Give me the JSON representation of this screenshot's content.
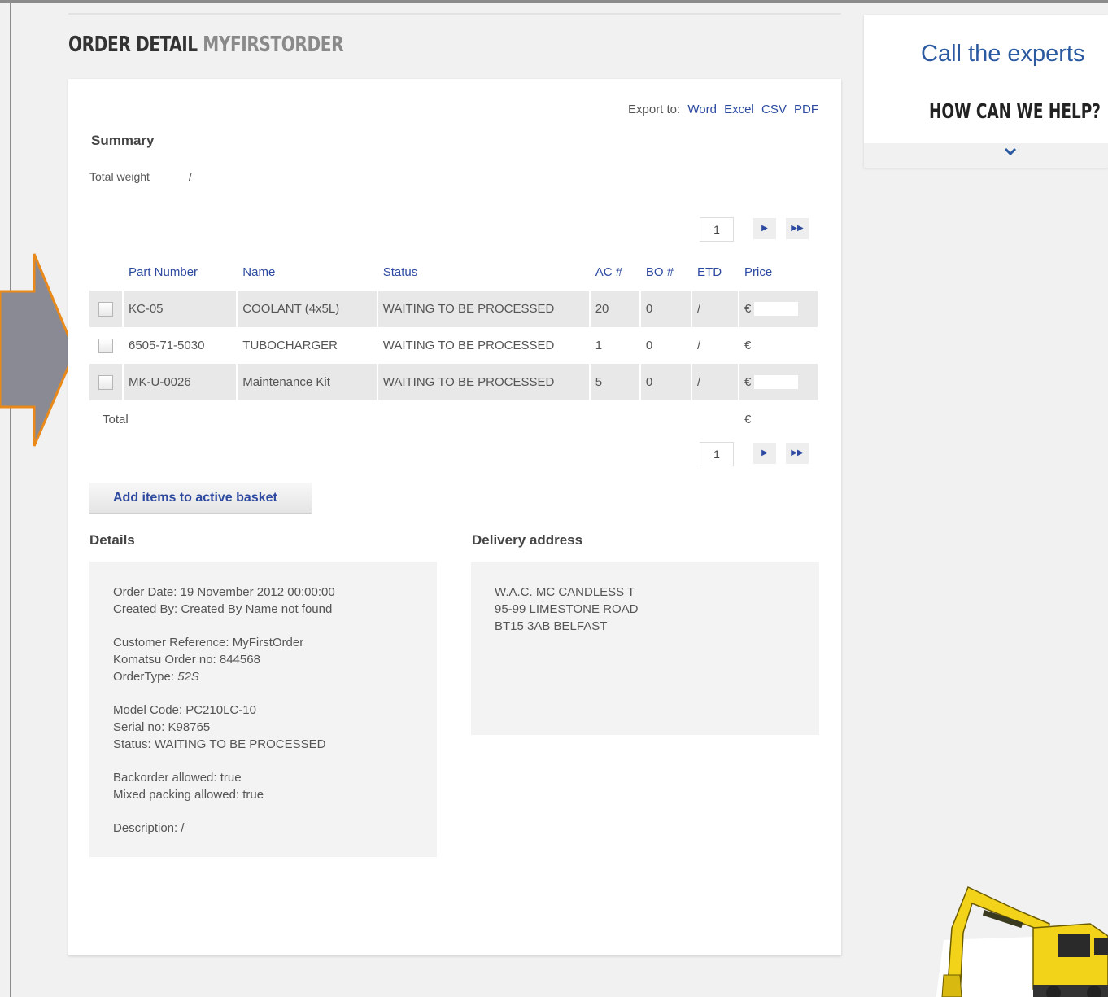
{
  "page": {
    "title_main": "ORDER DETAIL",
    "title_sub": "MYFIRSTORDER"
  },
  "export": {
    "label": "Export to:",
    "links": [
      "Word",
      "Excel",
      "CSV",
      "PDF"
    ]
  },
  "summary": {
    "heading": "Summary",
    "weight_label": "Total weight",
    "weight_value": "/"
  },
  "pager": {
    "page": "1"
  },
  "table": {
    "columns": [
      "Part Number",
      "Name",
      "Status",
      "AC #",
      "BO #",
      "ETD",
      "Price"
    ],
    "rows": [
      {
        "part": "KC-05",
        "name": "COOLANT (4x5L)",
        "status": "WAITING TO BE PROCESSED",
        "ac": "20",
        "bo": "0",
        "etd": "/",
        "price": "€"
      },
      {
        "part": "6505-71-5030",
        "name": "TUBOCHARGER",
        "status": "WAITING TO BE PROCESSED",
        "ac": "1",
        "bo": "0",
        "etd": "/",
        "price": "€"
      },
      {
        "part": "MK-U-0026",
        "name": "Maintenance Kit",
        "status": "WAITING TO BE PROCESSED",
        "ac": "5",
        "bo": "0",
        "etd": "/",
        "price": "€"
      }
    ],
    "total_label": "Total",
    "total_price": "€"
  },
  "actions": {
    "add_basket": "Add items to active basket"
  },
  "details": {
    "heading": "Details",
    "order_date": "Order Date: 19 November 2012 00:00:00",
    "created_by": "Created By: Created By Name not found",
    "customer_ref": "Customer Reference: MyFirstOrder",
    "order_no": "Komatsu Order no: 844568",
    "order_type_label": "OrderType:",
    "order_type_value": "52S",
    "model_code": "Model Code: PC210LC-10",
    "serial_no": "Serial no: K98765",
    "status": "Status: WAITING TO BE PROCESSED",
    "backorder": "Backorder allowed: true",
    "mixed_packing": "Mixed packing allowed: true",
    "description": "Description: /"
  },
  "delivery": {
    "heading": "Delivery address",
    "line1": "W.A.C. MC CANDLESS T",
    "line2": "95-99 LIMESTONE ROAD",
    "line3": "BT15 3AB BELFAST"
  },
  "help": {
    "call": "Call the experts",
    "how": "HOW CAN WE HELP?"
  },
  "colors": {
    "link": "#2d4aa0",
    "arrow_fill": "#8a8a94",
    "arrow_stroke": "#e8891a",
    "excavator_yellow": "#f3d31a"
  },
  "icons": {
    "next": "triangle-right",
    "last": "double-triangle-right",
    "expand": "chevron-down",
    "arrow": "callout-arrow-right"
  }
}
